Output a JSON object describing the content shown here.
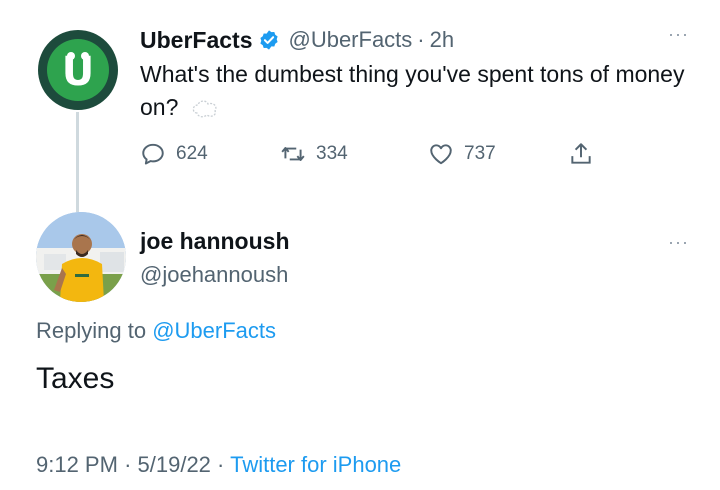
{
  "tweet": {
    "display_name": "UberFacts",
    "handle": "@UberFacts",
    "separator": "·",
    "age": "2h",
    "text": "What's the dumbest thing you've spent tons of money on?",
    "avatar_letter": "U",
    "avatar_colors": {
      "outer": "#1d4b3c",
      "inner": "#2ea34e"
    },
    "stats": {
      "replies": "624",
      "retweets": "334",
      "likes": "737"
    }
  },
  "reply": {
    "display_name": "joe hannoush",
    "handle": "@joehannoush",
    "replying_prefix": "Replying to",
    "replying_to": "@UberFacts",
    "text": "Taxes",
    "time": "9:12 PM",
    "date": "5/19/22",
    "separator": "·",
    "source": "Twitter for iPhone"
  },
  "more_label": "···",
  "colors": {
    "text": "#0f1419",
    "secondary": "#536471",
    "link": "#1d9bf0",
    "verified": "#1d9bf0"
  }
}
